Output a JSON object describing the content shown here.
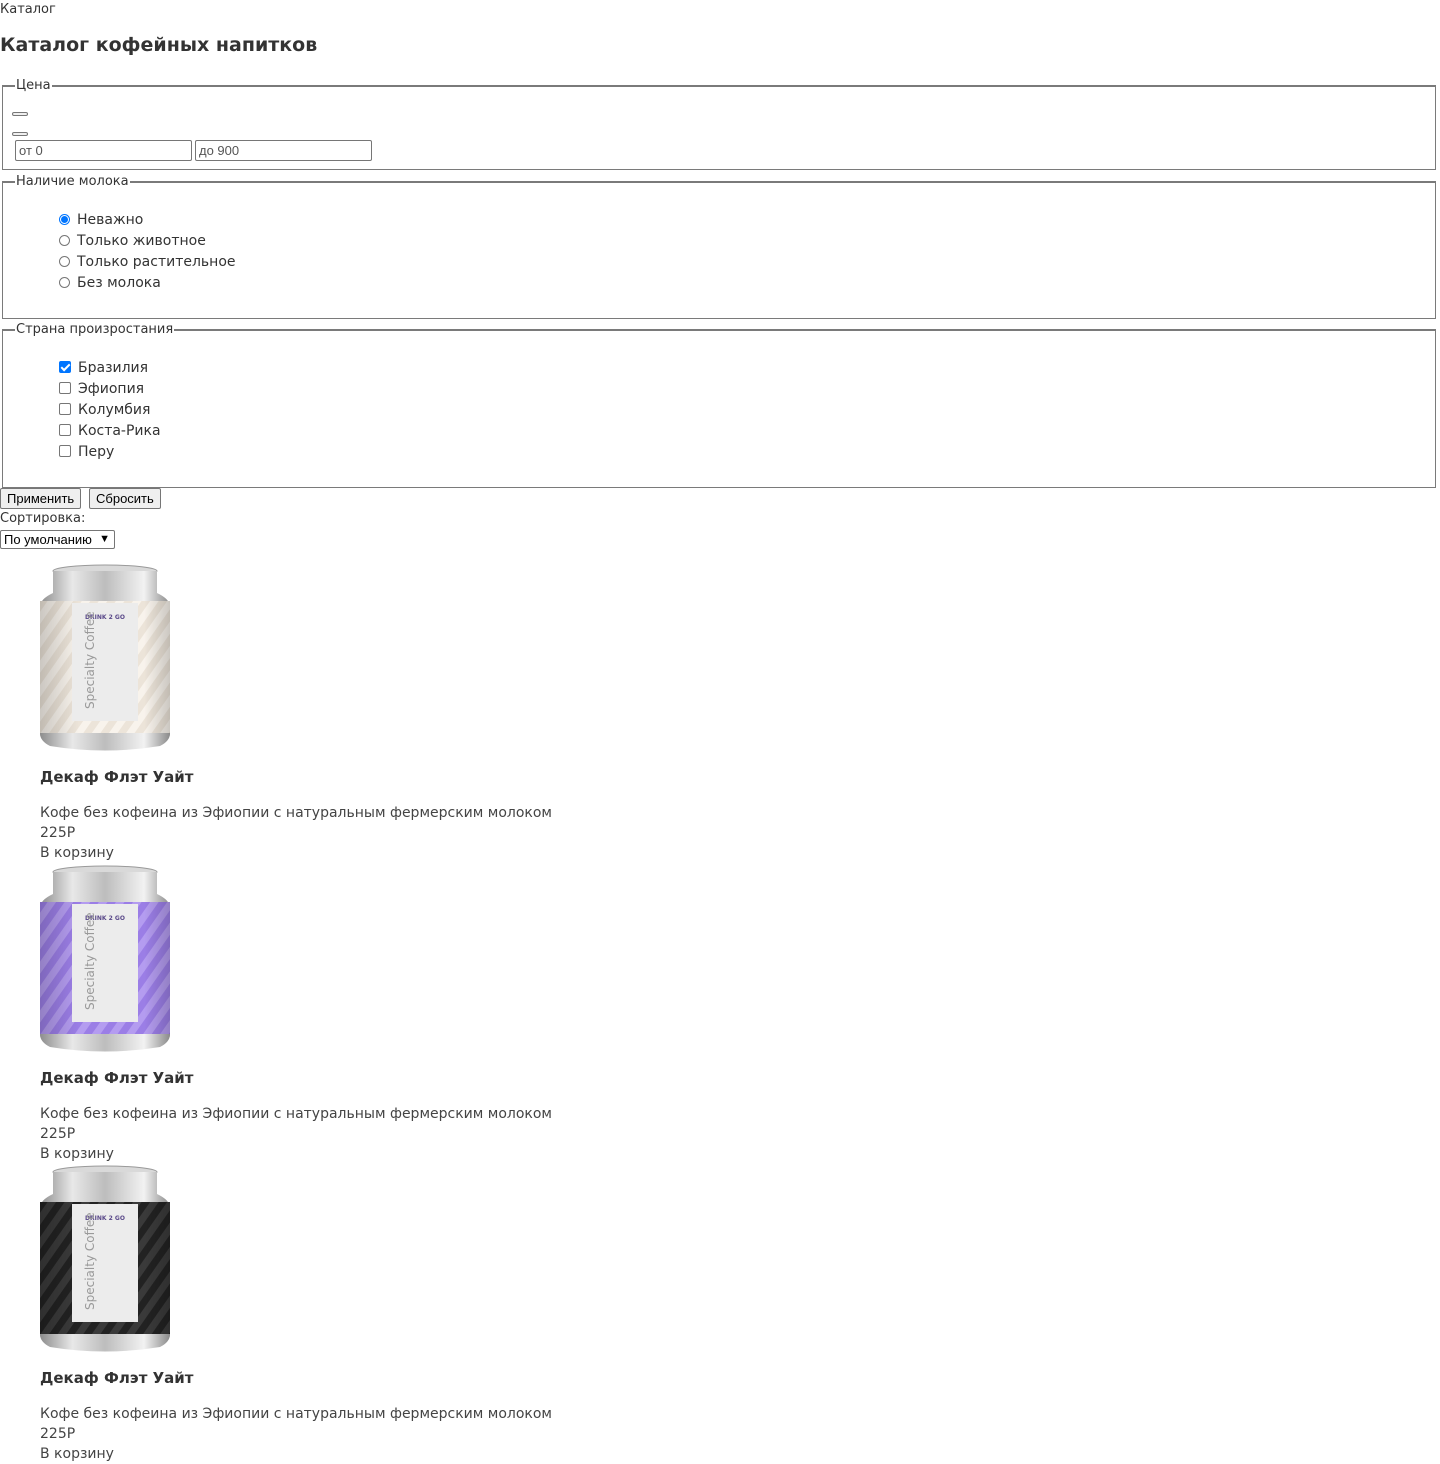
{
  "breadcrumb": "Каталог",
  "page_title": "Каталог кофейных напитков",
  "filters": {
    "price": {
      "legend": "Цена",
      "from_placeholder": "от 0",
      "to_placeholder": "до 900"
    },
    "milk": {
      "legend": "Наличие молока",
      "options": [
        "Неважно",
        "Только животное",
        "Только растительное",
        "Без молока"
      ],
      "selected": "Неважно"
    },
    "country": {
      "legend": "Страна произростания",
      "options": [
        "Бразилия",
        "Эфиопия",
        "Колумбия",
        "Коста-Рика",
        "Перу"
      ],
      "checked": [
        "Бразилия"
      ]
    },
    "apply_label": "Применить",
    "reset_label": "Сбросить"
  },
  "sort": {
    "label": "Сортировка:",
    "selected": "По умолчанию"
  },
  "products": [
    {
      "title": "Декаф Флэт Уайт",
      "description": "Кофе без кофеина из Эфиопии с натуральным фермерским молоком",
      "price": "225Р",
      "cart_label": "В корзину",
      "label_color": "#ece4d9",
      "stripe_color": "#f8f3ec",
      "brand": "DRINK 2 GO",
      "can_text": "Specialty Coffee"
    },
    {
      "title": "Декаф Флэт Уайт",
      "description": "Кофе без кофеина из Эфиопии с натуральным фермерским молоком",
      "price": "225Р",
      "cart_label": "В корзину",
      "label_color": "#9b7ee6",
      "stripe_color": "#b49cf0",
      "brand": "DRINK 2 GO",
      "can_text": "Specialty Coffee"
    },
    {
      "title": "Декаф Флэт Уайт",
      "description": "Кофе без кофеина из Эфиопии с натуральным фермерским молоком",
      "price": "225Р",
      "cart_label": "В корзину",
      "label_color": "#222222",
      "stripe_color": "#3a3a3a",
      "brand": "DRINK 2 GO",
      "can_text": "Specialty Coffee"
    }
  ]
}
